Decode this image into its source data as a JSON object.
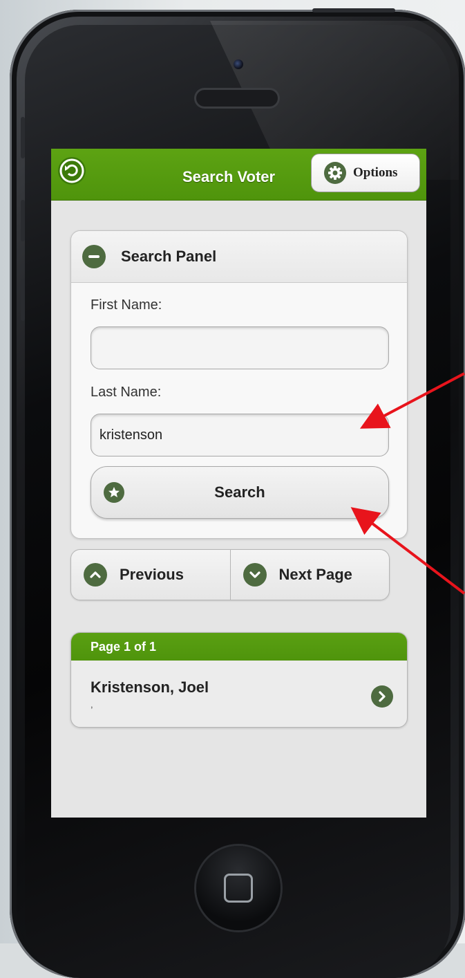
{
  "header": {
    "title": "Search Voter",
    "options_label": "Options"
  },
  "panel": {
    "title": "Search Panel",
    "first_name_label": "First Name:",
    "first_name_value": "",
    "last_name_label": "Last Name:",
    "last_name_value": "kristenson",
    "search_label": "Search"
  },
  "pager": {
    "previous_label": "Previous",
    "next_label": "Next Page"
  },
  "results": {
    "page_label": "Page 1 of 1",
    "items": [
      {
        "name": "Kristenson, Joel",
        "sub": ","
      }
    ]
  },
  "colors": {
    "header_green": "#5da313",
    "icon_green": "#4e6b40",
    "annotation_red": "#e8141c"
  },
  "icons": [
    "back-icon",
    "gear-icon",
    "minus-circle-icon",
    "star-icon",
    "chevron-up-icon",
    "chevron-down-icon",
    "chevron-right-icon",
    "home-button-icon"
  ]
}
